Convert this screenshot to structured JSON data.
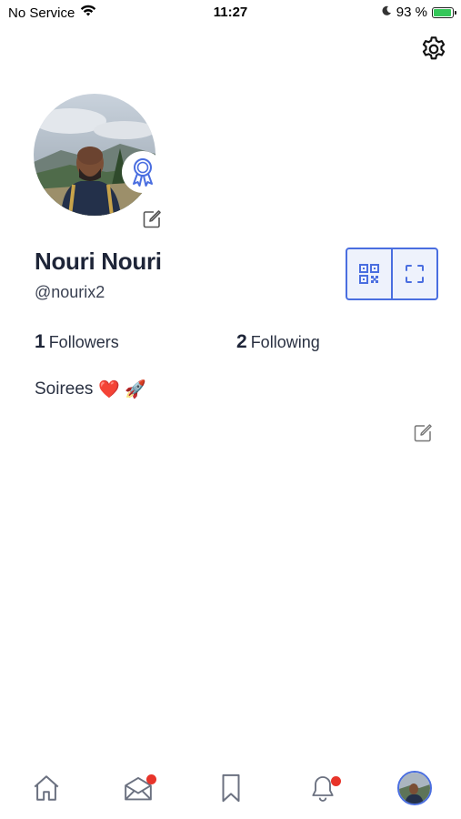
{
  "status_bar": {
    "carrier": "No Service",
    "time": "11:27",
    "battery_percent": "93 %",
    "battery_level": 0.93
  },
  "profile": {
    "display_name": "Nouri Nouri",
    "username": "@nourix2",
    "followers_count": "1",
    "followers_label": "Followers",
    "following_count": "2",
    "following_label": "Following",
    "bio_text": "Soirees",
    "bio_emojis": "❤️ 🚀"
  },
  "tab_bar": {
    "items": [
      {
        "icon": "home-icon",
        "notification": false
      },
      {
        "icon": "messages-icon",
        "notification": true
      },
      {
        "icon": "bookmark-icon",
        "notification": false
      },
      {
        "icon": "bell-icon",
        "notification": true
      },
      {
        "icon": "profile-avatar",
        "notification": false
      }
    ]
  },
  "colors": {
    "accent": "#4a6ee0",
    "notification": "#e8342a",
    "text_primary": "#1e2538",
    "icon_gray": "#6b7180"
  }
}
